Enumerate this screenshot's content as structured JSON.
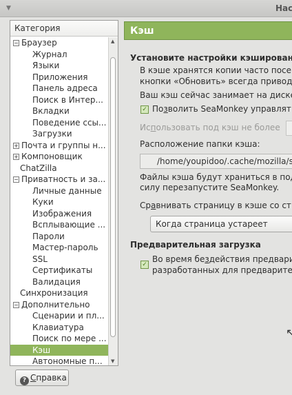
{
  "window": {
    "title": "Нас"
  },
  "tree": {
    "header": "Категория",
    "rows": [
      {
        "label": "Браузер",
        "level": 0,
        "expander": "−"
      },
      {
        "label": "Журнал",
        "level": 2
      },
      {
        "label": "Языки",
        "level": 2
      },
      {
        "label": "Приложения",
        "level": 2
      },
      {
        "label": "Панель адреса",
        "level": 2
      },
      {
        "label": "Поиск в Интер...",
        "level": 2
      },
      {
        "label": "Вкладки",
        "level": 2
      },
      {
        "label": "Поведение ссы...",
        "level": 2
      },
      {
        "label": "Загрузки",
        "level": 2
      },
      {
        "label": "Почта и группы н...",
        "level": 0,
        "expander": "+"
      },
      {
        "label": "Компоновщик",
        "level": 0,
        "expander": "+"
      },
      {
        "label": "ChatZilla",
        "level": 1
      },
      {
        "label": "Приватность и за...",
        "level": 0,
        "expander": "−"
      },
      {
        "label": "Личные данные",
        "level": 2
      },
      {
        "label": "Куки",
        "level": 2
      },
      {
        "label": "Изображения",
        "level": 2
      },
      {
        "label": "Всплывающие ...",
        "level": 2
      },
      {
        "label": "Пароли",
        "level": 2
      },
      {
        "label": "Мастер-пароль",
        "level": 2
      },
      {
        "label": "SSL",
        "level": 2
      },
      {
        "label": "Сертификаты",
        "level": 2
      },
      {
        "label": "Валидация",
        "level": 2
      },
      {
        "label": "Синхронизация",
        "level": 1
      },
      {
        "label": "Дополнительно",
        "level": 0,
        "expander": "−"
      },
      {
        "label": "Сценарии и пл...",
        "level": 2
      },
      {
        "label": "Клавиатура",
        "level": 2
      },
      {
        "label": "Поиск по мере ...",
        "level": 2
      },
      {
        "label": "Кэш",
        "level": 2,
        "selected": true
      },
      {
        "label": "Автономные п...",
        "level": 2
      }
    ]
  },
  "help_button": {
    "mnemonic": "С",
    "rest": "правка"
  },
  "panel": {
    "title": "Кэш",
    "cache_section_title": "Установите настройки кэширован",
    "cache_desc_1": "В кэше хранятся копии часто посе",
    "cache_desc_2": "кнопки «Обновить» всегда привод",
    "cache_usage": "Ваш кэш сейчас занимает на диске",
    "allow_manage": {
      "before": "По",
      "mnemonic": "з",
      "after": "волить SeaMonkey управлят",
      "checked": true
    },
    "use_limit": {
      "before": "Ис",
      "mnemonic": "п",
      "after": "ользовать под кэш не более"
    },
    "folder_label": "Расположение папки кэша:",
    "folder_path": "/home/youpidoo/.cache/mozilla/se",
    "folder_note_1": "Файлы кэша будут храниться в под",
    "folder_note_2": "силу перезапустите SeaMonkey.",
    "compare": {
      "before": "Ср",
      "mnemonic": "а",
      "after": "внивать страницу в кэше со ст"
    },
    "compare_value": "Когда страница устареет",
    "prefetch_title": "Предварительная загрузка",
    "prefetch": {
      "line1_before": "Во время бе",
      "mnemonic": "з",
      "line1_after": "действия предвари",
      "line2": "разработанных для предварите",
      "checked": true
    }
  },
  "colors": {
    "accent": "#8fb55b",
    "selection": "#8fb55b"
  }
}
